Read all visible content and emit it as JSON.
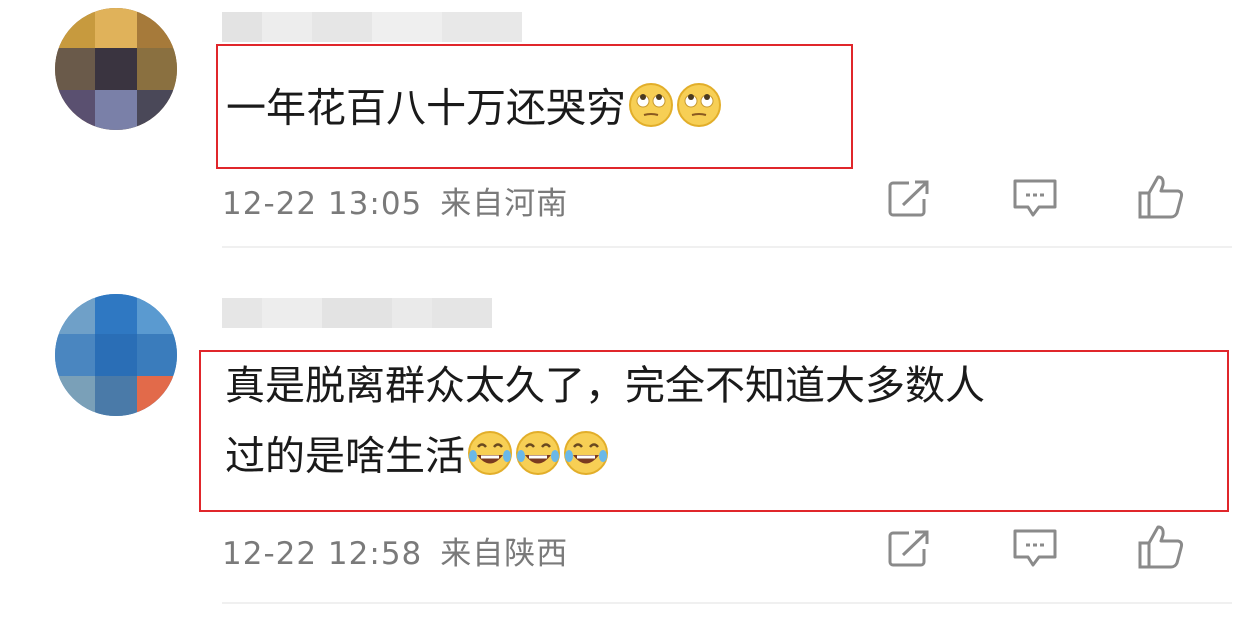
{
  "comments": [
    {
      "text_lines": [
        "一年花百八十万还哭穷"
      ],
      "emoji": "rolling-eyes-emoji",
      "emoji_count": 2,
      "date": "12-22 13:05",
      "location": "来自河南"
    },
    {
      "text_lines": [
        "真是脱离群众太久了，完全不知道大多数人",
        "过的是啥生活"
      ],
      "emoji": "tears-of-joy-emoji",
      "emoji_count": 3,
      "date": "12-22 12:58",
      "location": "来自陕西"
    }
  ],
  "actions": [
    "share-icon",
    "comment-icon",
    "like-icon"
  ],
  "colors": {
    "highlight_border": "#e0262b",
    "meta_text": "#7a7a7a"
  }
}
